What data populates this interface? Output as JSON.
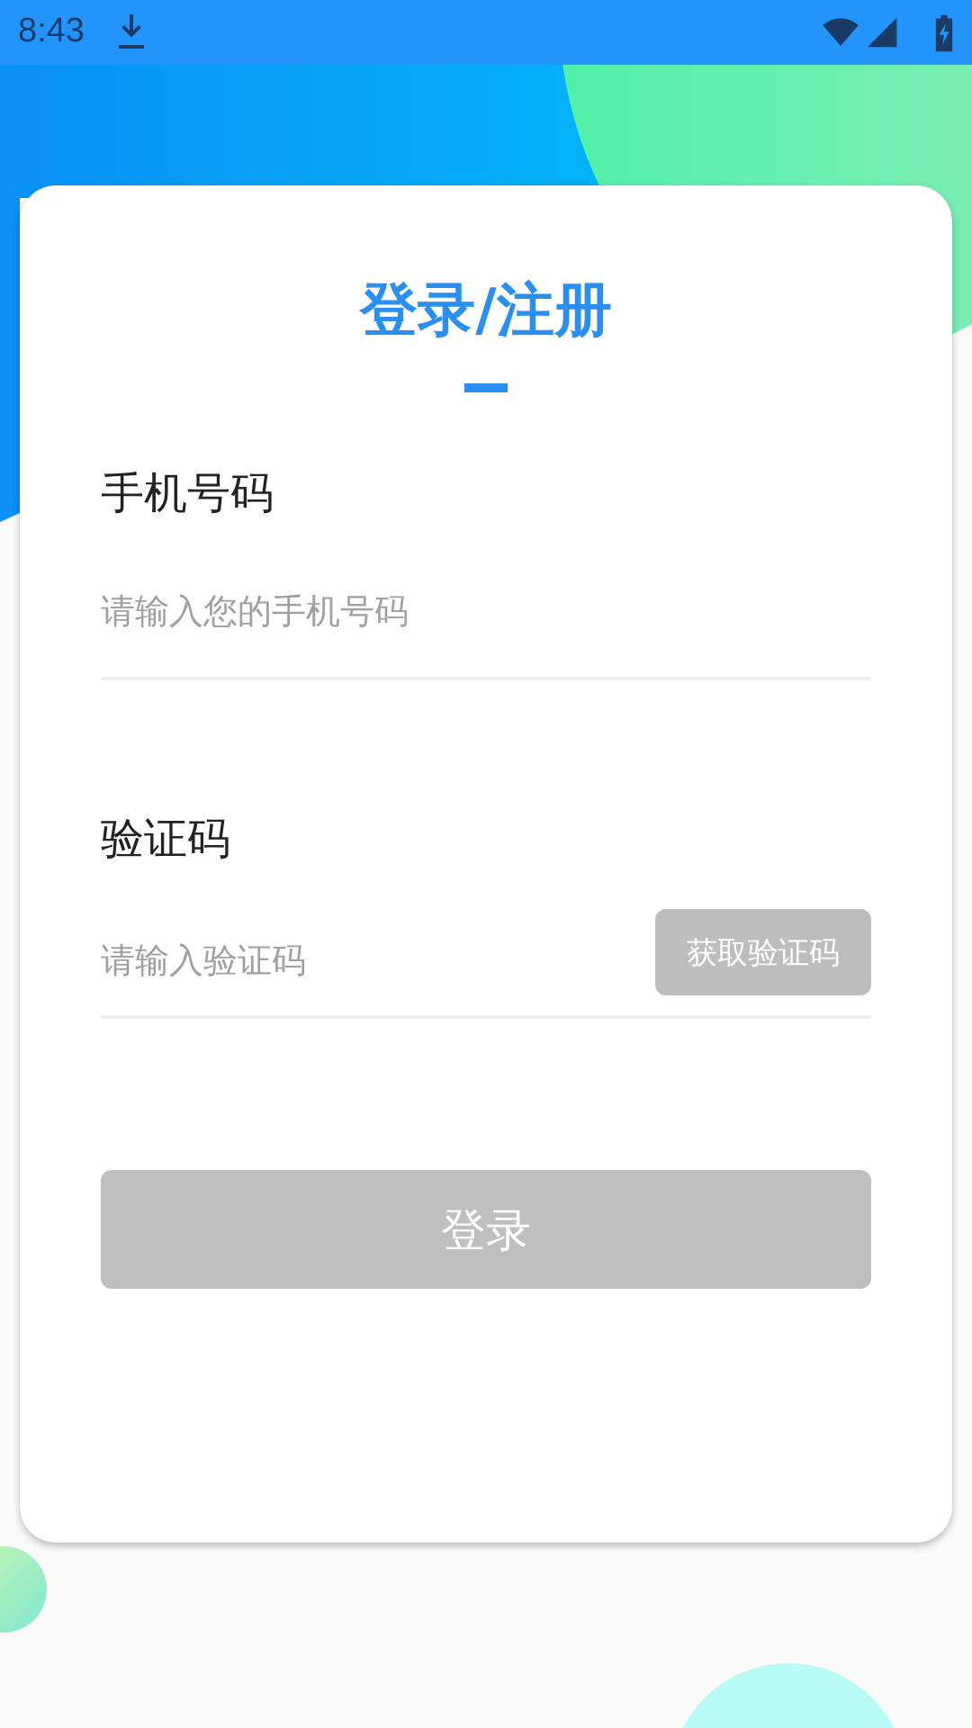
{
  "status_bar": {
    "time": "8:43"
  },
  "form": {
    "title": "登录/注册",
    "fields": [
      {
        "label": "手机号码",
        "placeholder": "请输入您的手机号码"
      },
      {
        "label": "验证码",
        "placeholder": "请输入验证码",
        "action": {
          "label": "获取验证码",
          "disabled": true
        }
      }
    ],
    "submit": {
      "label": "登录",
      "disabled": true
    }
  }
}
